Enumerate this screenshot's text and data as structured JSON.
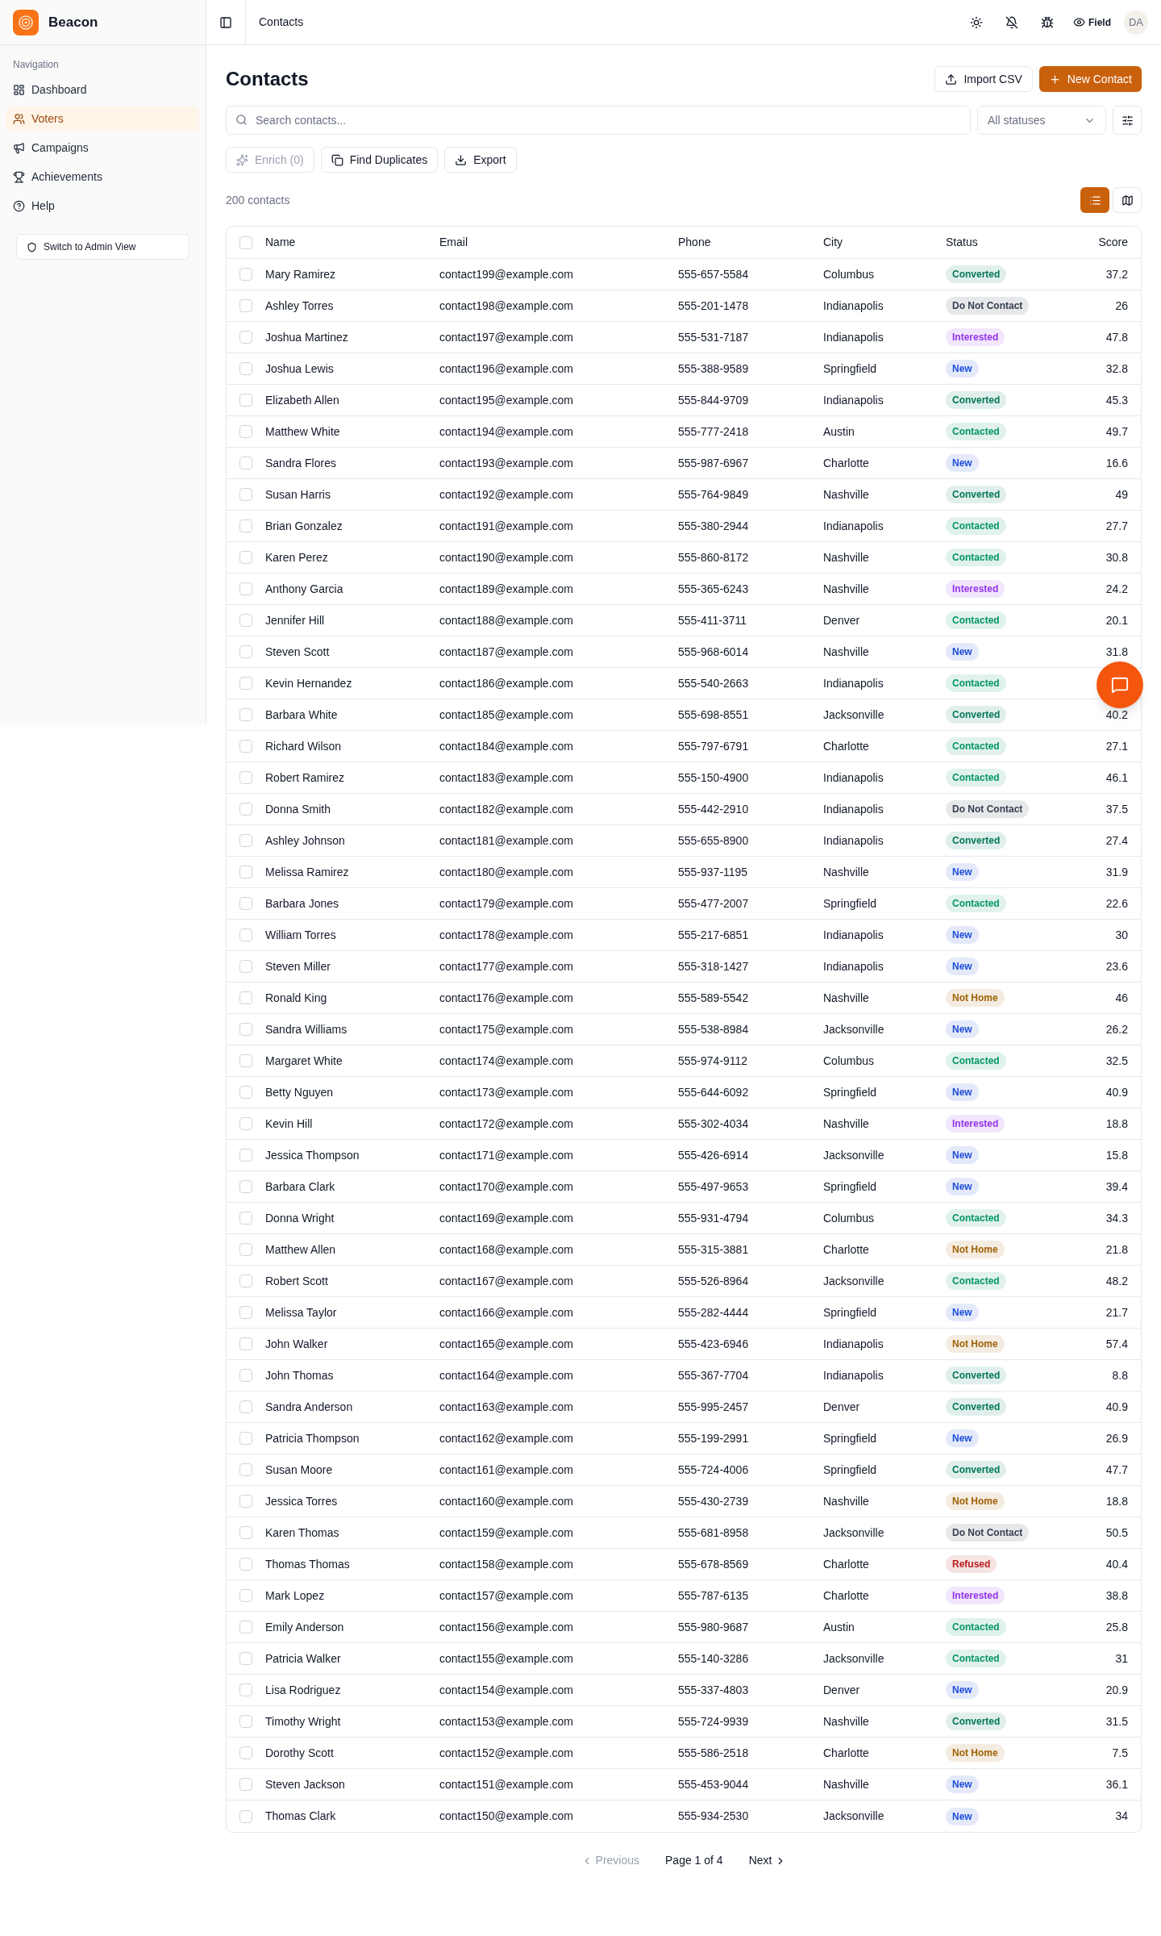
{
  "app": {
    "name": "Beacon"
  },
  "sidebar": {
    "section_title": "Navigation",
    "items": [
      {
        "label": "Dashboard",
        "selected": false
      },
      {
        "label": "Voters",
        "selected": true
      },
      {
        "label": "Campaigns",
        "selected": false
      },
      {
        "label": "Achievements",
        "selected": false
      },
      {
        "label": "Help",
        "selected": false
      }
    ],
    "admin_button": "Switch to Admin View"
  },
  "topbar": {
    "breadcrumb": "Contacts",
    "field_label": "Field",
    "avatar": "DA"
  },
  "page": {
    "title": "Contacts",
    "import_button": "Import CSV",
    "new_button": "New Contact",
    "search": {
      "placeholder": "Search contacts..."
    },
    "status_filter": "All statuses",
    "enrich_button": {
      "label": "Enrich (0)",
      "disabled": true
    },
    "duplicates_button": "Find Duplicates",
    "export_button": "Export",
    "count": "200 contacts",
    "views": [
      {
        "selected": true
      },
      {
        "selected": false
      }
    ]
  },
  "table": {
    "columns": [
      "Name",
      "Email",
      "Phone",
      "City",
      "Status",
      "Score"
    ],
    "all_checked": false,
    "rows": [
      {
        "checked": false,
        "name": "Mary Ramirez",
        "email": "contact199@example.com",
        "phone": "555-657-5584",
        "city": "Columbus",
        "status": "Converted",
        "color": "#047857",
        "score": "37.2"
      },
      {
        "checked": false,
        "name": "Ashley Torres",
        "email": "contact198@example.com",
        "phone": "555-201-1478",
        "city": "Indianapolis",
        "status": "Do Not Contact",
        "color": "#374151",
        "score": "26"
      },
      {
        "checked": false,
        "name": "Joshua Martinez",
        "email": "contact197@example.com",
        "phone": "555-531-7187",
        "city": "Indianapolis",
        "status": "Interested",
        "color": "#9333ea",
        "score": "47.8"
      },
      {
        "checked": false,
        "name": "Joshua Lewis",
        "email": "contact196@example.com",
        "phone": "555-388-9589",
        "city": "Springfield",
        "status": "New",
        "color": "#1d4ed8",
        "score": "32.8"
      },
      {
        "checked": false,
        "name": "Elizabeth Allen",
        "email": "contact195@example.com",
        "phone": "555-844-9709",
        "city": "Indianapolis",
        "status": "Converted",
        "color": "#047857",
        "score": "45.3"
      },
      {
        "checked": false,
        "name": "Matthew White",
        "email": "contact194@example.com",
        "phone": "555-777-2418",
        "city": "Austin",
        "status": "Contacted",
        "color": "#059669",
        "score": "49.7"
      },
      {
        "checked": false,
        "name": "Sandra Flores",
        "email": "contact193@example.com",
        "phone": "555-987-6967",
        "city": "Charlotte",
        "status": "New",
        "color": "#1d4ed8",
        "score": "16.6"
      },
      {
        "checked": false,
        "name": "Susan Harris",
        "email": "contact192@example.com",
        "phone": "555-764-9849",
        "city": "Nashville",
        "status": "Converted",
        "color": "#047857",
        "score": "49"
      },
      {
        "checked": false,
        "name": "Brian Gonzalez",
        "email": "contact191@example.com",
        "phone": "555-380-2944",
        "city": "Indianapolis",
        "status": "Contacted",
        "color": "#059669",
        "score": "27.7"
      },
      {
        "checked": false,
        "name": "Karen Perez",
        "email": "contact190@example.com",
        "phone": "555-860-8172",
        "city": "Nashville",
        "status": "Contacted",
        "color": "#059669",
        "score": "30.8"
      },
      {
        "checked": false,
        "name": "Anthony Garcia",
        "email": "contact189@example.com",
        "phone": "555-365-6243",
        "city": "Nashville",
        "status": "Interested",
        "color": "#9333ea",
        "score": "24.2"
      },
      {
        "checked": false,
        "name": "Jennifer Hill",
        "email": "contact188@example.com",
        "phone": "555-411-3711",
        "city": "Denver",
        "status": "Contacted",
        "color": "#059669",
        "score": "20.1"
      },
      {
        "checked": false,
        "name": "Steven Scott",
        "email": "contact187@example.com",
        "phone": "555-968-6014",
        "city": "Nashville",
        "status": "New",
        "color": "#1d4ed8",
        "score": "31.8"
      },
      {
        "checked": false,
        "name": "Kevin Hernandez",
        "email": "contact186@example.com",
        "phone": "555-540-2663",
        "city": "Indianapolis",
        "status": "Contacted",
        "color": "#059669"
      },
      {
        "checked": false,
        "name": "Barbara White",
        "email": "contact185@example.com",
        "phone": "555-698-8551",
        "city": "Jacksonville",
        "status": "Converted",
        "color": "#047857",
        "score": "40.2"
      },
      {
        "checked": false,
        "name": "Richard Wilson",
        "email": "contact184@example.com",
        "phone": "555-797-6791",
        "city": "Charlotte",
        "status": "Contacted",
        "color": "#059669",
        "score": "27.1"
      },
      {
        "checked": false,
        "name": "Robert Ramirez",
        "email": "contact183@example.com",
        "phone": "555-150-4900",
        "city": "Indianapolis",
        "status": "Contacted",
        "color": "#059669",
        "score": "46.1"
      },
      {
        "checked": false,
        "name": "Donna Smith",
        "email": "contact182@example.com",
        "phone": "555-442-2910",
        "city": "Indianapolis",
        "status": "Do Not Contact",
        "color": "#374151",
        "score": "37.5"
      },
      {
        "checked": false,
        "name": "Ashley Johnson",
        "email": "contact181@example.com",
        "phone": "555-655-8900",
        "city": "Indianapolis",
        "status": "Converted",
        "color": "#047857",
        "score": "27.4"
      },
      {
        "checked": false,
        "name": "Melissa Ramirez",
        "email": "contact180@example.com",
        "phone": "555-937-1195",
        "city": "Nashville",
        "status": "New",
        "color": "#1d4ed8",
        "score": "31.9"
      },
      {
        "checked": false,
        "name": "Barbara Jones",
        "email": "contact179@example.com",
        "phone": "555-477-2007",
        "city": "Springfield",
        "status": "Contacted",
        "color": "#059669",
        "score": "22.6"
      },
      {
        "checked": false,
        "name": "William Torres",
        "email": "contact178@example.com",
        "phone": "555-217-6851",
        "city": "Indianapolis",
        "status": "New",
        "color": "#1d4ed8",
        "score": "30"
      },
      {
        "checked": false,
        "name": "Steven Miller",
        "email": "contact177@example.com",
        "phone": "555-318-1427",
        "city": "Indianapolis",
        "status": "New",
        "color": "#1d4ed8",
        "score": "23.6"
      },
      {
        "checked": false,
        "name": "Ronald King",
        "email": "contact176@example.com",
        "phone": "555-589-5542",
        "city": "Nashville",
        "status": "Not Home",
        "color": "#a16207",
        "score": "46"
      },
      {
        "checked": false,
        "name": "Sandra Williams",
        "email": "contact175@example.com",
        "phone": "555-538-8984",
        "city": "Jacksonville",
        "status": "New",
        "color": "#1d4ed8",
        "score": "26.2"
      },
      {
        "checked": false,
        "name": "Margaret White",
        "email": "contact174@example.com",
        "phone": "555-974-9112",
        "city": "Columbus",
        "status": "Contacted",
        "color": "#059669",
        "score": "32.5"
      },
      {
        "checked": false,
        "name": "Betty Nguyen",
        "email": "contact173@example.com",
        "phone": "555-644-6092",
        "city": "Springfield",
        "status": "New",
        "color": "#1d4ed8",
        "score": "40.9"
      },
      {
        "checked": false,
        "name": "Kevin Hill",
        "email": "contact172@example.com",
        "phone": "555-302-4034",
        "city": "Nashville",
        "status": "Interested",
        "color": "#9333ea",
        "score": "18.8"
      },
      {
        "checked": false,
        "name": "Jessica Thompson",
        "email": "contact171@example.com",
        "phone": "555-426-6914",
        "city": "Jacksonville",
        "status": "New",
        "color": "#1d4ed8",
        "score": "15.8"
      },
      {
        "checked": false,
        "name": "Barbara Clark",
        "email": "contact170@example.com",
        "phone": "555-497-9653",
        "city": "Springfield",
        "status": "New",
        "color": "#1d4ed8",
        "score": "39.4"
      },
      {
        "checked": false,
        "name": "Donna Wright",
        "email": "contact169@example.com",
        "phone": "555-931-4794",
        "city": "Columbus",
        "status": "Contacted",
        "color": "#059669",
        "score": "34.3"
      },
      {
        "checked": false,
        "name": "Matthew Allen",
        "email": "contact168@example.com",
        "phone": "555-315-3881",
        "city": "Charlotte",
        "status": "Not Home",
        "color": "#a16207",
        "score": "21.8"
      },
      {
        "checked": false,
        "name": "Robert Scott",
        "email": "contact167@example.com",
        "phone": "555-526-8964",
        "city": "Jacksonville",
        "status": "Contacted",
        "color": "#059669",
        "score": "48.2"
      },
      {
        "checked": false,
        "name": "Melissa Taylor",
        "email": "contact166@example.com",
        "phone": "555-282-4444",
        "city": "Springfield",
        "status": "New",
        "color": "#1d4ed8",
        "score": "21.7"
      },
      {
        "checked": false,
        "name": "John Walker",
        "email": "contact165@example.com",
        "phone": "555-423-6946",
        "city": "Indianapolis",
        "status": "Not Home",
        "color": "#a16207",
        "score": "57.4"
      },
      {
        "checked": false,
        "name": "John Thomas",
        "email": "contact164@example.com",
        "phone": "555-367-7704",
        "city": "Indianapolis",
        "status": "Converted",
        "color": "#047857",
        "score": "8.8"
      },
      {
        "checked": false,
        "name": "Sandra Anderson",
        "email": "contact163@example.com",
        "phone": "555-995-2457",
        "city": "Denver",
        "status": "Converted",
        "color": "#047857",
        "score": "40.9"
      },
      {
        "checked": false,
        "name": "Patricia Thompson",
        "email": "contact162@example.com",
        "phone": "555-199-2991",
        "city": "Springfield",
        "status": "New",
        "color": "#1d4ed8",
        "score": "26.9"
      },
      {
        "checked": false,
        "name": "Susan Moore",
        "email": "contact161@example.com",
        "phone": "555-724-4006",
        "city": "Springfield",
        "status": "Converted",
        "color": "#047857",
        "score": "47.7"
      },
      {
        "checked": false,
        "name": "Jessica Torres",
        "email": "contact160@example.com",
        "phone": "555-430-2739",
        "city": "Nashville",
        "status": "Not Home",
        "color": "#a16207",
        "score": "18.8"
      },
      {
        "checked": false,
        "name": "Karen Thomas",
        "email": "contact159@example.com",
        "phone": "555-681-8958",
        "city": "Jacksonville",
        "status": "Do Not Contact",
        "color": "#374151",
        "score": "50.5"
      },
      {
        "checked": false,
        "name": "Thomas Thomas",
        "email": "contact158@example.com",
        "phone": "555-678-8569",
        "city": "Charlotte",
        "status": "Refused",
        "color": "#b91c1c",
        "score": "40.4"
      },
      {
        "checked": false,
        "name": "Mark Lopez",
        "email": "contact157@example.com",
        "phone": "555-787-6135",
        "city": "Charlotte",
        "status": "Interested",
        "color": "#9333ea",
        "score": "38.8"
      },
      {
        "checked": false,
        "name": "Emily Anderson",
        "email": "contact156@example.com",
        "phone": "555-980-9687",
        "city": "Austin",
        "status": "Contacted",
        "color": "#059669",
        "score": "25.8"
      },
      {
        "checked": false,
        "name": "Patricia Walker",
        "email": "contact155@example.com",
        "phone": "555-140-3286",
        "city": "Jacksonville",
        "status": "Contacted",
        "color": "#059669",
        "score": "31"
      },
      {
        "checked": false,
        "name": "Lisa Rodriguez",
        "email": "contact154@example.com",
        "phone": "555-337-4803",
        "city": "Denver",
        "status": "New",
        "color": "#1d4ed8",
        "score": "20.9"
      },
      {
        "checked": false,
        "name": "Timothy Wright",
        "email": "contact153@example.com",
        "phone": "555-724-9939",
        "city": "Nashville",
        "status": "Converted",
        "color": "#047857",
        "score": "31.5"
      },
      {
        "checked": false,
        "name": "Dorothy Scott",
        "email": "contact152@example.com",
        "phone": "555-586-2518",
        "city": "Charlotte",
        "status": "Not Home",
        "color": "#a16207",
        "score": "7.5"
      },
      {
        "checked": false,
        "name": "Steven Jackson",
        "email": "contact151@example.com",
        "phone": "555-453-9044",
        "city": "Nashville",
        "status": "New",
        "color": "#1d4ed8",
        "score": "36.1"
      },
      {
        "checked": false,
        "name": "Thomas Clark",
        "email": "contact150@example.com",
        "phone": "555-934-2530",
        "city": "Jacksonville",
        "status": "New",
        "color": "#1d4ed8",
        "score": "34"
      }
    ]
  },
  "pagination": {
    "previous": {
      "label": "Previous",
      "disabled": true
    },
    "page_info": "Page 1 of 4",
    "next": {
      "label": "Next",
      "disabled": false
    }
  }
}
